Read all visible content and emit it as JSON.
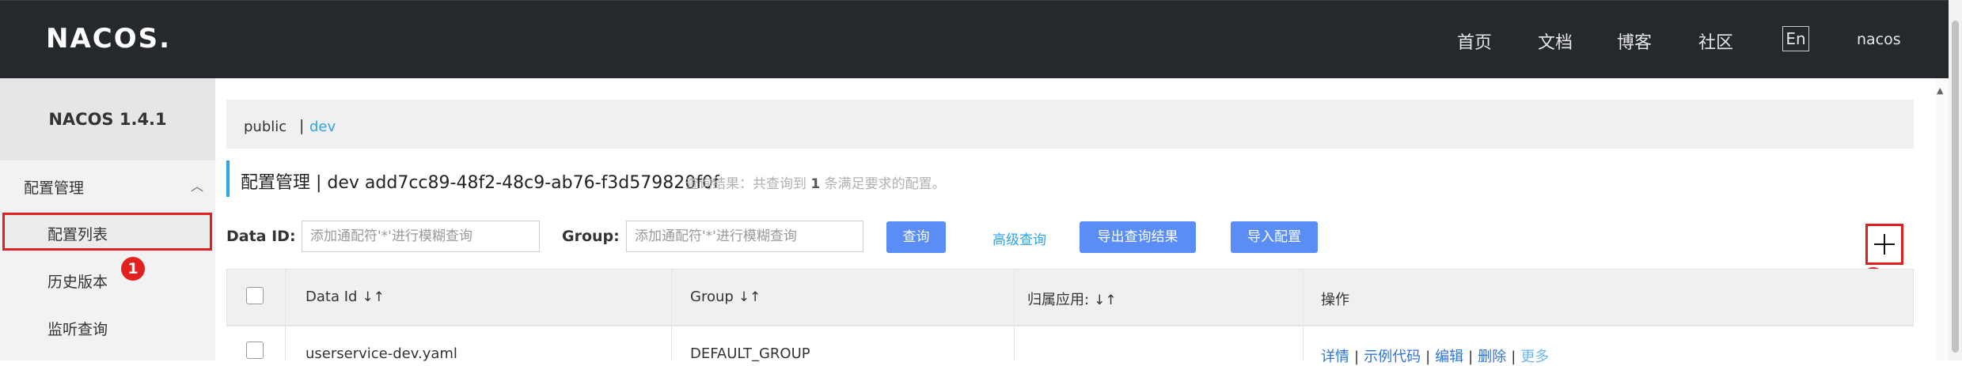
{
  "header": {
    "logo": "NACOS.",
    "nav": [
      "首页",
      "文档",
      "博客",
      "社区"
    ],
    "lang": "En",
    "user": "nacos"
  },
  "sidebar": {
    "version": "NACOS 1.4.1",
    "group_label": "配置管理",
    "items": [
      "配置列表",
      "历史版本",
      "监听查询"
    ]
  },
  "markers": [
    "1",
    "2"
  ],
  "namespace": {
    "public": "public",
    "separator": "|",
    "dev": "dev"
  },
  "title": {
    "text": "配置管理 | dev  add7cc89-48f2-48c9-ab76-f3d579820f0f",
    "result_prefix": "查询结果：共查询到",
    "result_count": "1",
    "result_suffix": "条满足要求的配置。"
  },
  "filters": {
    "data_id_label": "Data ID:",
    "data_id_placeholder": "添加通配符'*'进行模糊查询",
    "group_label": "Group:",
    "group_placeholder": "添加通配符'*'进行模糊查询",
    "query_button": "查询",
    "advanced_link": "高级查询",
    "export_button": "导出查询结果",
    "import_button": "导入配置"
  },
  "table": {
    "columns": [
      "Data Id",
      "Group",
      "归属应用:",
      "操作"
    ],
    "sort_icon": "↓↑",
    "rows": [
      {
        "data_id": "userservice-dev.yaml",
        "group": "DEFAULT_GROUP",
        "app": "",
        "ops": [
          "详情",
          "示例代码",
          "编辑",
          "删除",
          "更多"
        ]
      }
    ]
  },
  "colors": {
    "topbar": "#25282c",
    "accent": "#2fa4e7",
    "button": "#5a8df5",
    "marker": "#e32020"
  }
}
